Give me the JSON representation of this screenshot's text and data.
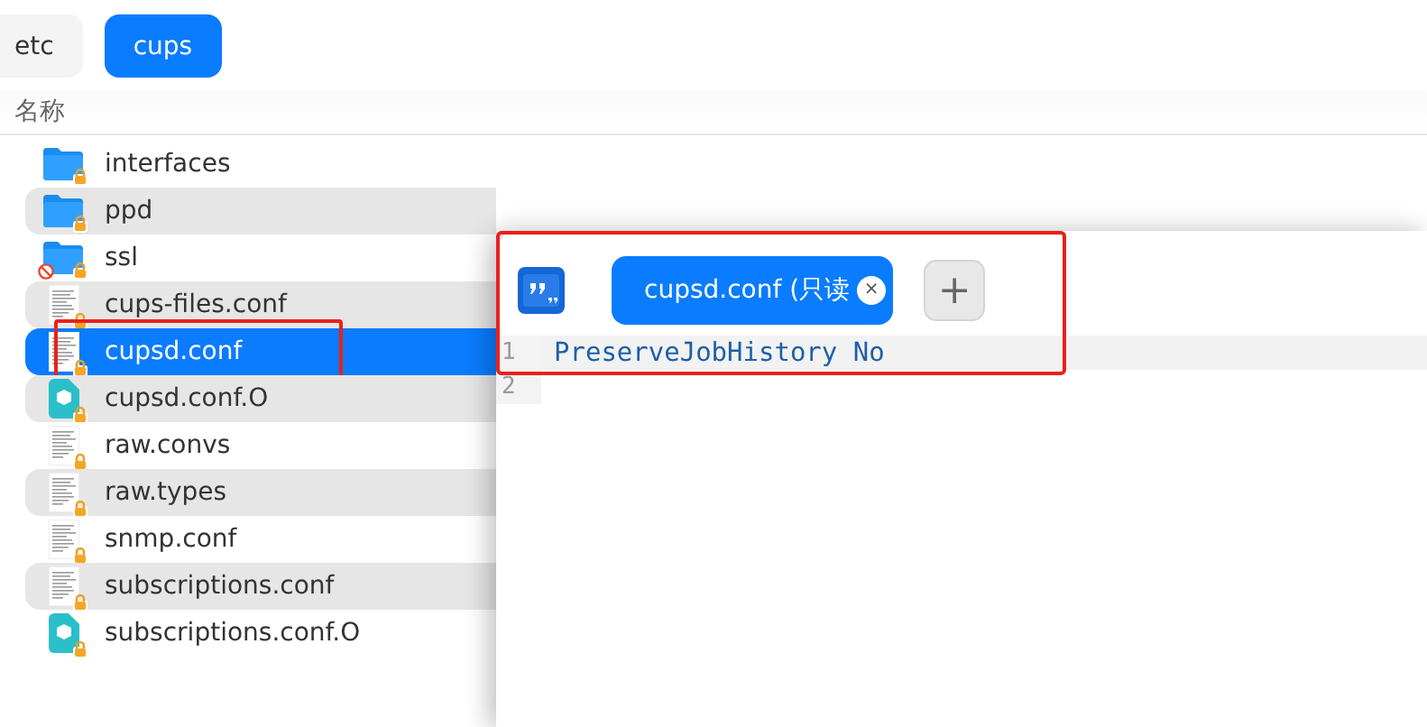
{
  "breadcrumb": [
    {
      "label": "etc",
      "selected": false
    },
    {
      "label": "cups",
      "selected": true
    }
  ],
  "file_list": {
    "column_header": "名称",
    "rows": [
      {
        "name": "interfaces",
        "kind": "folder",
        "selected": false,
        "highlighted": false,
        "blocked": false
      },
      {
        "name": "ppd",
        "kind": "folder",
        "selected": false,
        "highlighted": false,
        "blocked": false
      },
      {
        "name": "ssl",
        "kind": "folder",
        "selected": false,
        "highlighted": false,
        "blocked": true
      },
      {
        "name": "cups-files.conf",
        "kind": "text",
        "selected": false,
        "highlighted": false,
        "blocked": false
      },
      {
        "name": "cupsd.conf",
        "kind": "text",
        "selected": true,
        "highlighted": true,
        "blocked": false
      },
      {
        "name": "cupsd.conf.O",
        "kind": "package",
        "selected": false,
        "highlighted": false,
        "blocked": false
      },
      {
        "name": "raw.convs",
        "kind": "text",
        "selected": false,
        "highlighted": false,
        "blocked": false
      },
      {
        "name": "raw.types",
        "kind": "text",
        "selected": false,
        "highlighted": false,
        "blocked": false
      },
      {
        "name": "snmp.conf",
        "kind": "text",
        "selected": false,
        "highlighted": false,
        "blocked": false
      },
      {
        "name": "subscriptions.conf",
        "kind": "text",
        "selected": false,
        "highlighted": false,
        "blocked": false
      },
      {
        "name": "subscriptions.conf.O",
        "kind": "package",
        "selected": false,
        "highlighted": false,
        "blocked": false
      }
    ]
  },
  "editor": {
    "highlighted": true,
    "tabs": [
      {
        "label": "cupsd.conf (只读",
        "selected": true,
        "close": "×"
      }
    ],
    "new_tab": "+",
    "lines": [
      {
        "number": "1",
        "text": "PreserveJobHistory No",
        "current": true
      },
      {
        "number": "2",
        "current": false
      }
    ]
  }
}
